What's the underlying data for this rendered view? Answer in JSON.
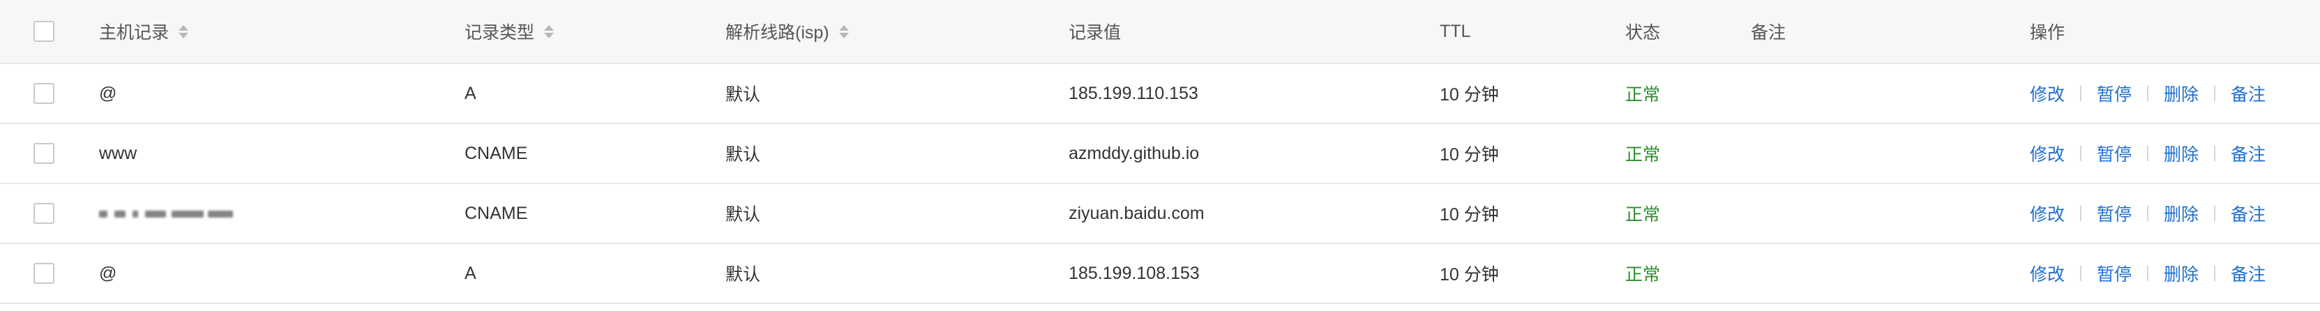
{
  "header": {
    "host": "主机记录",
    "type": "记录类型",
    "line": "解析线路(isp)",
    "value": "记录值",
    "ttl": "TTL",
    "status": "状态",
    "note": "备注",
    "ops": "操作"
  },
  "rows": [
    {
      "host": "@",
      "type": "A",
      "line": "默认",
      "value": "185.199.110.153",
      "ttl": "10 分钟",
      "status": "正常",
      "note": ""
    },
    {
      "host": "www",
      "type": "CNAME",
      "line": "默认",
      "value": "azmddy.github.io",
      "ttl": "10 分钟",
      "status": "正常",
      "note": ""
    },
    {
      "host": "",
      "type": "CNAME",
      "line": "默认",
      "value": "ziyuan.baidu.com",
      "ttl": "10 分钟",
      "status": "正常",
      "note": ""
    },
    {
      "host": "@",
      "type": "A",
      "line": "默认",
      "value": "185.199.108.153",
      "ttl": "10 分钟",
      "status": "正常",
      "note": ""
    }
  ],
  "actions": {
    "edit": "修改",
    "pause": "暂停",
    "delete": "删除",
    "note": "备注"
  },
  "colors": {
    "link": "#1f6fd1",
    "status_ok": "#2e8b2e",
    "header_bg": "#f7f7f7",
    "border": "#e8e8e8"
  }
}
